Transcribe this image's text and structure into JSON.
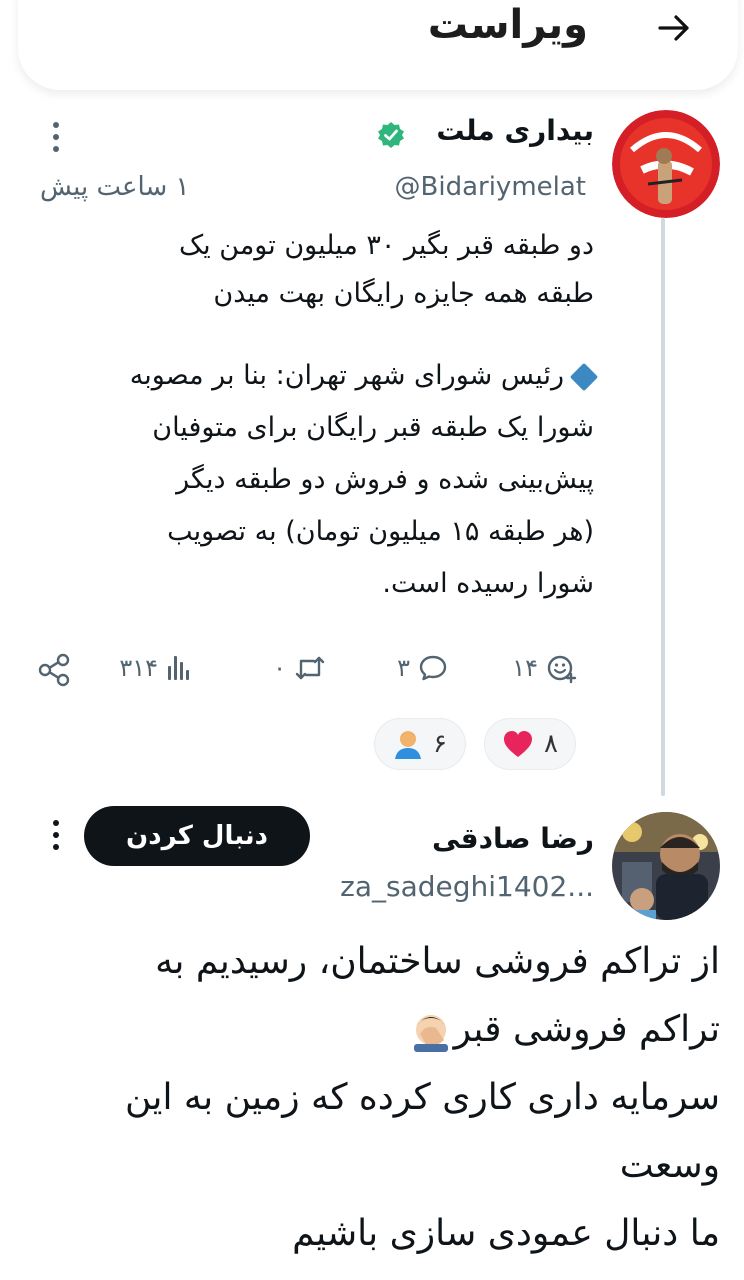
{
  "header": {
    "title": "ویراست",
    "back_icon": "arrow-right-icon"
  },
  "tweet1": {
    "author_name": "بیداری ملت",
    "verified_color": "#2eb67d",
    "handle": "@Bidariymelat",
    "time": "۱ ساعت پیش",
    "line1": "دو طبقه قبر بگیر ۳۰ میلیون تومن یک",
    "line2": "طبقه همه جایزه رایگان بهت میدن",
    "quote_l1": "رئیس شورای شهر تهران: بنا بر مصوبه",
    "quote_l2": "شورا یک طبقه قبر رایگان برای متوفیان",
    "quote_l3": "پیش‌بینی شده و فروش دو طبقه دیگر",
    "quote_l4": "(هر طبقه ۱۵ میلیون تومان) به تصویب",
    "quote_l5": "شورا رسیده است.",
    "reactions_count": "۱۴",
    "replies_count": "۳",
    "reposts_count": "۰",
    "views_count": "۳۱۴",
    "pill_heart_count": "۸",
    "pill_person_count": "۶"
  },
  "tweet2": {
    "author_name": "رضا صادقی",
    "handle": "za_sadeghi1402...",
    "follow_label": "دنبال کردن",
    "line1": "از تراکم فروشی ساختمان، رسیدیم به",
    "line2": "تراکم فروشی قبر",
    "line3": "سرمایه داری کاری کرده که زمین به این",
    "line4": "وسعت",
    "line5": "ما دنبال عمودی سازی باشیم"
  },
  "colors": {
    "accent_dark": "#0f1419",
    "muted": "#536471",
    "thread_line": "#cfd9de",
    "heart": "#e8245c"
  }
}
